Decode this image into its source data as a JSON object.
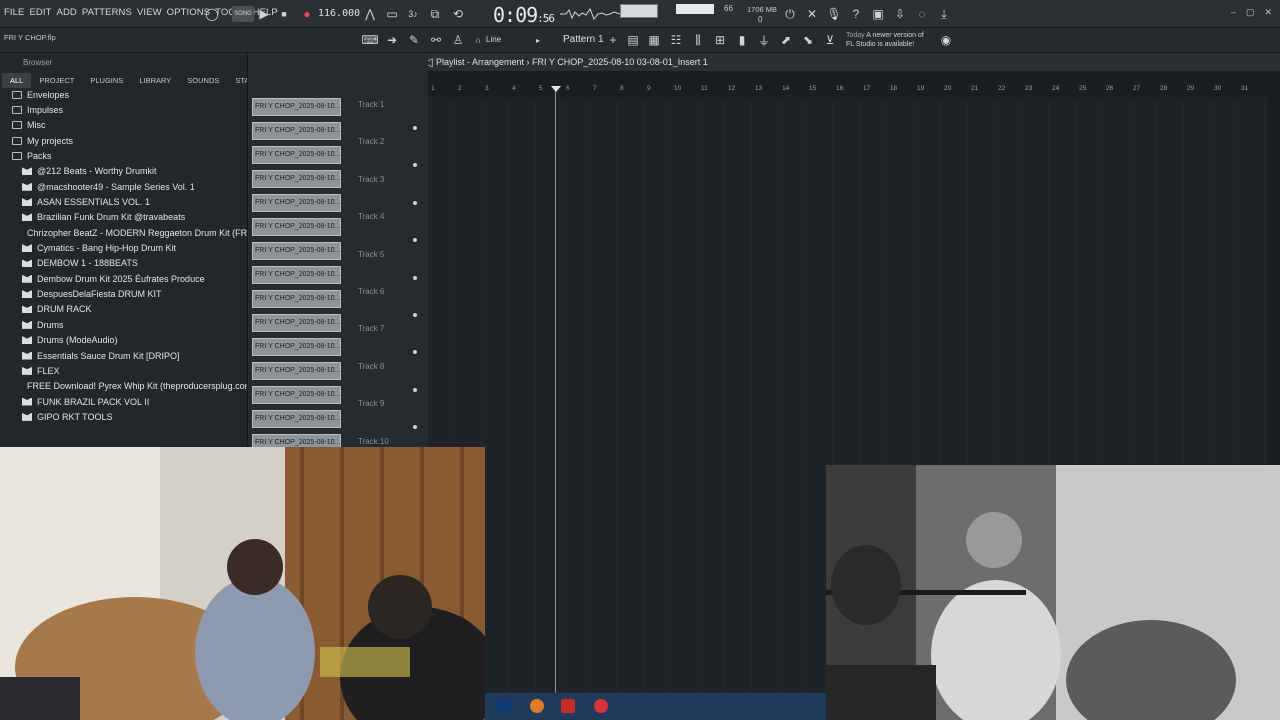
{
  "menu": [
    "FILE",
    "EDIT",
    "ADD",
    "PATTERNS",
    "VIEW",
    "OPTIONS",
    "TOOLS",
    "HELP"
  ],
  "transport": {
    "mode_label": "SONG",
    "tempo": "116.000",
    "time_main": "0:09",
    "time_sub": "56"
  },
  "meters": {
    "volume_value": "66",
    "volume_value2": "0",
    "memory": "1706 MB"
  },
  "project_file": "FRI Y CHOP.flp",
  "snap_mode": "Line",
  "pattern": "Pattern 1",
  "notification": {
    "line1": "Today",
    "line2": "A newer version of",
    "line3": "FL Studio is available!"
  },
  "browser": {
    "title": "Browser",
    "tabs": [
      "ALL",
      "PROJECT",
      "PLUGINS",
      "LIBRARY",
      "SOUNDS",
      "STARRED"
    ],
    "active_tab": "ALL",
    "folders": [
      "Envelopes",
      "Impulses",
      "Misc",
      "My projects",
      "Packs"
    ],
    "packs": [
      "@212 Beats - Worthy Drumkit",
      "@macshooter49 - Sample Series Vol. 1",
      "ASAN ESSENTIALS VOL. 1",
      "Brazilian Funk Drum Kit @travabeats",
      "Chrizopher BeatZ - MODERN Reggaeton Drum Kit (FREE)",
      "Cymatics - Bang Hip-Hop Drum Kit",
      "DEMBOW 1 - 188BEATS",
      "Dembow Drum Kit 2025 Éufrates Produce",
      "DespuesDelaFiesta DRUM KIT",
      "DRUM RACK",
      "Drums",
      "Drums (ModeAudio)",
      "Essentials Sauce Drum Kit [DRIPO]",
      "FLEX",
      "FREE Download! Pyrex Whip Kit (theproducersplug.com)",
      "FUNK BRAZIL PACK VOL II",
      "GIPO RKT TOOLS"
    ]
  },
  "playlist": {
    "title": "Playlist - Arrangement",
    "breadcrumb": "FRI Y CHOP_2025-08-10 03-08-01_Insert 1",
    "clip_label": "FRI Y CHOP_2025-08-10...",
    "tracks": [
      "Track 1",
      "Track 2",
      "Track 3",
      "Track 4",
      "Track 5",
      "Track 6",
      "Track 7",
      "Track 8",
      "Track 9",
      "Track 10"
    ],
    "ruler": [
      "1",
      "2",
      "3",
      "4",
      "5",
      "6",
      "7",
      "8",
      "9",
      "10",
      "11",
      "12",
      "13",
      "14",
      "15",
      "16",
      "17",
      "18",
      "19",
      "20",
      "21",
      "22",
      "23",
      "24",
      "25",
      "26",
      "27",
      "28",
      "29",
      "30",
      "31"
    ]
  }
}
